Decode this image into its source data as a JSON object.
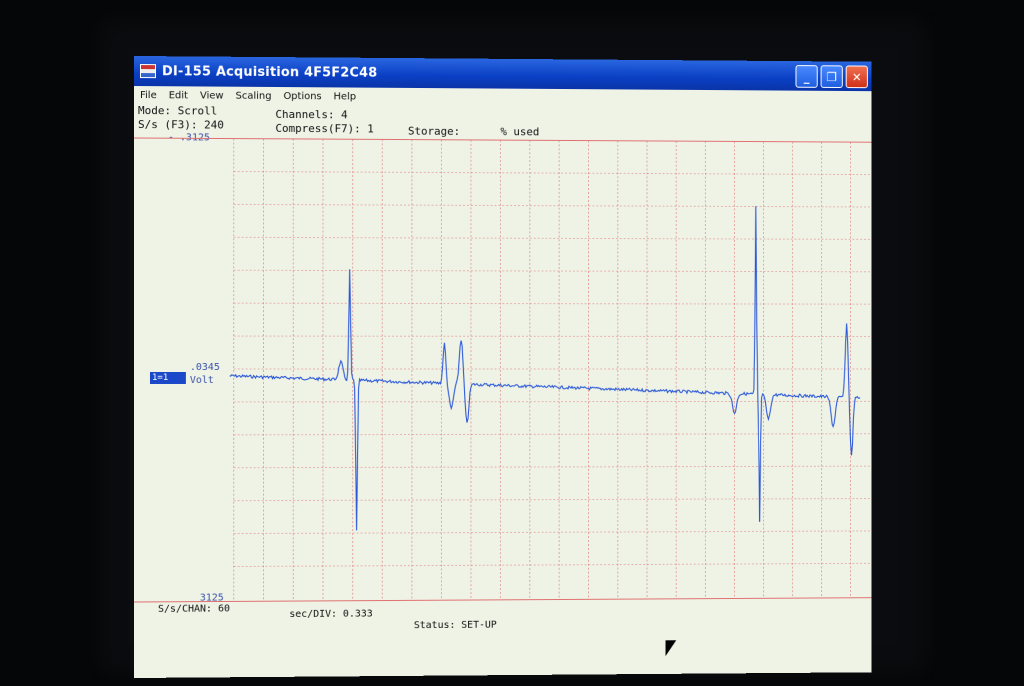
{
  "window": {
    "title": "DI-155 Acquisition 4F5F2C48",
    "buttons": {
      "minimize": "_",
      "restore": "❐",
      "close": "✕"
    }
  },
  "menu": [
    "File",
    "Edit",
    "View",
    "Scaling",
    "Options",
    "Help"
  ],
  "info": {
    "mode": "Mode: Scroll",
    "sps": "S/s (F3): 240",
    "channels": "Channels: 4",
    "compress": "Compress(F7): 1",
    "storage": "Storage:",
    "used": "% used"
  },
  "axis": {
    "top": "- .3125",
    "mid": ".0345",
    "bottom": "3125",
    "channel": "1=1",
    "unit": "Volt"
  },
  "status": {
    "schan": "S/s/CHAN: 60",
    "secdiv": "sec/DIV: 0.333",
    "state": "Status: SET-UP"
  },
  "colors": {
    "grid": "#e07070",
    "trace": "#2b58d8",
    "titlebar": "#0a3fc4"
  }
}
